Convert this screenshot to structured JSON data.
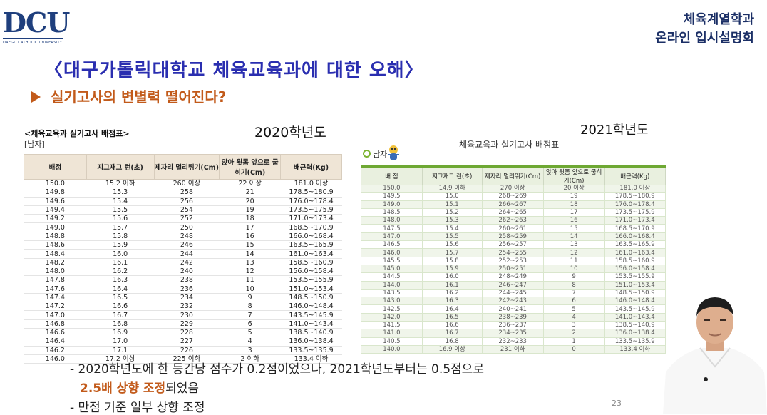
{
  "logo": {
    "text": "DCU",
    "subtitle": "DAEGU CATHOLIC UNIVERSITY"
  },
  "header": {
    "line1": "체육계열학과",
    "line2": "온라인 입시설명회"
  },
  "slide": {
    "title": "〈대구가톨릭대학교 체육교육과에 대한 오해〉",
    "subtitle": "실기고사의 변별력 떨어진다?",
    "page_number": "23",
    "bullet1": "- 2020학년도에 한 등간당 점수가 0.2점이었으나, 2021학년도부터는 0.5점으로",
    "bullet2_highlight": "2.5배 상향 조정",
    "bullet2_rest": "되었음",
    "bullet3": "- 만점 기준 일부 상향 조정"
  },
  "table2020": {
    "heading": "<체육교육과 실기고사 배점표>",
    "gender": "[남자]",
    "year": "2020학년도",
    "headers": [
      "배점",
      "지그재그 런(초)",
      "제자리 멀리뛰기(Cm)",
      "앉아 윗몸 앞으로 굽히기(Cm)",
      "배근력(Kg)"
    ],
    "rows": [
      [
        "150.0",
        "15.2 이하",
        "260 이상",
        "22 이상",
        "181.0 이상"
      ],
      [
        "149.8",
        "15.3",
        "258",
        "21",
        "178.5~180.9"
      ],
      [
        "149.6",
        "15.4",
        "256",
        "20",
        "176.0~178.4"
      ],
      [
        "149.4",
        "15.5",
        "254",
        "19",
        "173.5~175.9"
      ],
      [
        "149.2",
        "15.6",
        "252",
        "18",
        "171.0~173.4"
      ],
      [
        "149.0",
        "15.7",
        "250",
        "17",
        "168.5~170.9"
      ],
      [
        "148.8",
        "15.8",
        "248",
        "16",
        "166.0~168.4"
      ],
      [
        "148.6",
        "15.9",
        "246",
        "15",
        "163.5~165.9"
      ],
      [
        "148.4",
        "16.0",
        "244",
        "14",
        "161.0~163.4"
      ],
      [
        "148.2",
        "16.1",
        "242",
        "13",
        "158.5~160.9"
      ],
      [
        "148.0",
        "16.2",
        "240",
        "12",
        "156.0~158.4"
      ],
      [
        "147.8",
        "16.3",
        "238",
        "11",
        "153.5~155.9"
      ],
      [
        "147.6",
        "16.4",
        "236",
        "10",
        "151.0~153.4"
      ],
      [
        "147.4",
        "16.5",
        "234",
        "9",
        "148.5~150.9"
      ],
      [
        "147.2",
        "16.6",
        "232",
        "8",
        "146.0~148.4"
      ],
      [
        "147.0",
        "16.7",
        "230",
        "7",
        "143.5~145.9"
      ],
      [
        "146.8",
        "16.8",
        "229",
        "6",
        "141.0~143.4"
      ],
      [
        "146.6",
        "16.9",
        "228",
        "5",
        "138.5~140.9"
      ],
      [
        "146.4",
        "17.0",
        "227",
        "4",
        "136.0~138.4"
      ],
      [
        "146.2",
        "17.1",
        "226",
        "3",
        "133.5~135.9"
      ],
      [
        "146.0",
        "17.2 이상",
        "225 이하",
        "2 이하",
        "133.4 이하"
      ]
    ]
  },
  "table2021": {
    "year": "2021학년도",
    "heading": "체육교육과 실기고사 배점표",
    "gender": "남자",
    "headers": [
      "배 점",
      "지그재그 런(초)",
      "제자리 멀리뛰기(Cm)",
      "앉아 윗몸 앞으로 굽히기(Cm)",
      "배근력(Kg)"
    ],
    "rows": [
      [
        "150.0",
        "14.9 이하",
        "270 이상",
        "20 이상",
        "181.0 이상"
      ],
      [
        "149.5",
        "15.0",
        "268~269",
        "19",
        "178.5~180.9"
      ],
      [
        "149.0",
        "15.1",
        "266~267",
        "18",
        "176.0~178.4"
      ],
      [
        "148.5",
        "15.2",
        "264~265",
        "17",
        "173.5~175.9"
      ],
      [
        "148.0",
        "15.3",
        "262~263",
        "16",
        "171.0~173.4"
      ],
      [
        "147.5",
        "15.4",
        "260~261",
        "15",
        "168.5~170.9"
      ],
      [
        "147.0",
        "15.5",
        "258~259",
        "14",
        "166.0~168.4"
      ],
      [
        "146.5",
        "15.6",
        "256~257",
        "13",
        "163.5~165.9"
      ],
      [
        "146.0",
        "15.7",
        "254~255",
        "12",
        "161.0~163.4"
      ],
      [
        "145.5",
        "15.8",
        "252~253",
        "11",
        "158.5~160.9"
      ],
      [
        "145.0",
        "15.9",
        "250~251",
        "10",
        "156.0~158.4"
      ],
      [
        "144.5",
        "16.0",
        "248~249",
        "9",
        "153.5~155.9"
      ],
      [
        "144.0",
        "16.1",
        "246~247",
        "8",
        "151.0~153.4"
      ],
      [
        "143.5",
        "16.2",
        "244~245",
        "7",
        "148.5~150.9"
      ],
      [
        "143.0",
        "16.3",
        "242~243",
        "6",
        "146.0~148.4"
      ],
      [
        "142.5",
        "16.4",
        "240~241",
        "5",
        "143.5~145.9"
      ],
      [
        "142.0",
        "16.5",
        "238~239",
        "4",
        "141.0~143.4"
      ],
      [
        "141.5",
        "16.6",
        "236~237",
        "3",
        "138.5~140.9"
      ],
      [
        "141.0",
        "16.7",
        "234~235",
        "2",
        "136.0~138.4"
      ],
      [
        "140.5",
        "16.8",
        "232~233",
        "1",
        "133.5~135.9"
      ],
      [
        "140.0",
        "16.9 이상",
        "231 이하",
        "0",
        "133.4 이하"
      ]
    ]
  },
  "colors": {
    "title": "#2a2eb0",
    "accent": "#c25a1a",
    "brand": "#1f3f7d",
    "table_green": "#6ea833"
  }
}
